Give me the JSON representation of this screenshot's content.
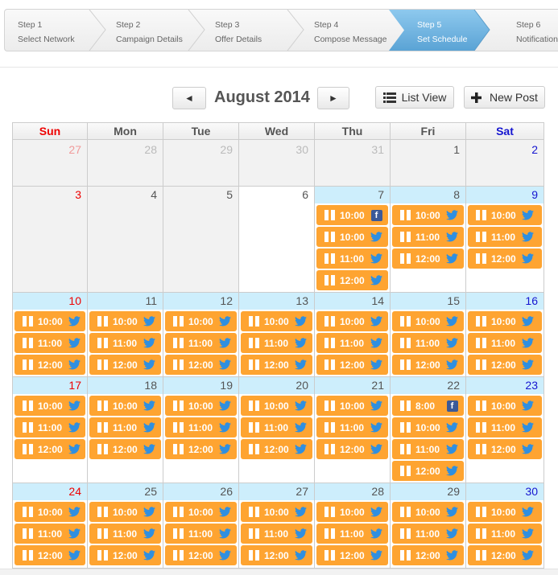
{
  "wizard": {
    "steps": [
      {
        "step": "Step 1",
        "label": "Select Network",
        "active": false
      },
      {
        "step": "Step 2",
        "label": "Campaign Details",
        "active": false
      },
      {
        "step": "Step 3",
        "label": "Offer Details",
        "active": false
      },
      {
        "step": "Step 4",
        "label": "Compose Message",
        "active": false
      },
      {
        "step": "Step 5",
        "label": "Set Schedule",
        "active": true
      },
      {
        "step": "Step 6",
        "label": "Notifications",
        "active": false
      }
    ]
  },
  "toolbar": {
    "prev_icon": "◄",
    "next_icon": "►",
    "month_title": "August 2014",
    "list_view_label": "List View",
    "list_view_icon": "list-icon",
    "new_post_label": "New Post",
    "new_post_icon": "plus-icon"
  },
  "colors": {
    "event_bg": "#fea431",
    "event_row_header": "#cdeefc",
    "active_step": "#6fb3e0",
    "sunday": "#e00000",
    "saturday": "#1515d0",
    "twitter": "#2f8fe0",
    "facebook": "#3b5998"
  },
  "calendar": {
    "days_of_week": [
      "Sun",
      "Mon",
      "Tue",
      "Wed",
      "Thu",
      "Fri",
      "Sat"
    ],
    "weeks": [
      [
        {
          "day": "27",
          "other": true,
          "events": []
        },
        {
          "day": "28",
          "other": true,
          "events": []
        },
        {
          "day": "29",
          "other": true,
          "events": []
        },
        {
          "day": "30",
          "other": true,
          "events": []
        },
        {
          "day": "31",
          "other": true,
          "events": []
        },
        {
          "day": "1",
          "other": false,
          "events": []
        },
        {
          "day": "2",
          "other": false,
          "events": []
        }
      ],
      [
        {
          "day": "3",
          "events": []
        },
        {
          "day": "4",
          "events": []
        },
        {
          "day": "5",
          "events": []
        },
        {
          "day": "6",
          "today": true,
          "events": []
        },
        {
          "day": "7",
          "events": [
            {
              "time": "10:00",
              "network": "facebook"
            },
            {
              "time": "10:00",
              "network": "twitter"
            },
            {
              "time": "11:00",
              "network": "twitter"
            },
            {
              "time": "12:00",
              "network": "twitter"
            }
          ]
        },
        {
          "day": "8",
          "events": [
            {
              "time": "10:00",
              "network": "twitter"
            },
            {
              "time": "11:00",
              "network": "twitter"
            },
            {
              "time": "12:00",
              "network": "twitter"
            }
          ]
        },
        {
          "day": "9",
          "events": [
            {
              "time": "10:00",
              "network": "twitter"
            },
            {
              "time": "11:00",
              "network": "twitter"
            },
            {
              "time": "12:00",
              "network": "twitter"
            }
          ]
        }
      ],
      [
        {
          "day": "10",
          "events": [
            {
              "time": "10:00",
              "network": "twitter"
            },
            {
              "time": "11:00",
              "network": "twitter"
            },
            {
              "time": "12:00",
              "network": "twitter"
            }
          ]
        },
        {
          "day": "11",
          "events": [
            {
              "time": "10:00",
              "network": "twitter"
            },
            {
              "time": "11:00",
              "network": "twitter"
            },
            {
              "time": "12:00",
              "network": "twitter"
            }
          ]
        },
        {
          "day": "12",
          "events": [
            {
              "time": "10:00",
              "network": "twitter"
            },
            {
              "time": "11:00",
              "network": "twitter"
            },
            {
              "time": "12:00",
              "network": "twitter"
            }
          ]
        },
        {
          "day": "13",
          "events": [
            {
              "time": "10:00",
              "network": "twitter"
            },
            {
              "time": "11:00",
              "network": "twitter"
            },
            {
              "time": "12:00",
              "network": "twitter"
            }
          ]
        },
        {
          "day": "14",
          "events": [
            {
              "time": "10:00",
              "network": "twitter"
            },
            {
              "time": "11:00",
              "network": "twitter"
            },
            {
              "time": "12:00",
              "network": "twitter"
            }
          ]
        },
        {
          "day": "15",
          "events": [
            {
              "time": "10:00",
              "network": "twitter"
            },
            {
              "time": "11:00",
              "network": "twitter"
            },
            {
              "time": "12:00",
              "network": "twitter"
            }
          ]
        },
        {
          "day": "16",
          "events": [
            {
              "time": "10:00",
              "network": "twitter"
            },
            {
              "time": "11:00",
              "network": "twitter"
            },
            {
              "time": "12:00",
              "network": "twitter"
            }
          ]
        }
      ],
      [
        {
          "day": "17",
          "events": [
            {
              "time": "10:00",
              "network": "twitter"
            },
            {
              "time": "11:00",
              "network": "twitter"
            },
            {
              "time": "12:00",
              "network": "twitter"
            }
          ]
        },
        {
          "day": "18",
          "events": [
            {
              "time": "10:00",
              "network": "twitter"
            },
            {
              "time": "11:00",
              "network": "twitter"
            },
            {
              "time": "12:00",
              "network": "twitter"
            }
          ]
        },
        {
          "day": "19",
          "events": [
            {
              "time": "10:00",
              "network": "twitter"
            },
            {
              "time": "11:00",
              "network": "twitter"
            },
            {
              "time": "12:00",
              "network": "twitter"
            }
          ]
        },
        {
          "day": "20",
          "events": [
            {
              "time": "10:00",
              "network": "twitter"
            },
            {
              "time": "11:00",
              "network": "twitter"
            },
            {
              "time": "12:00",
              "network": "twitter"
            }
          ]
        },
        {
          "day": "21",
          "events": [
            {
              "time": "10:00",
              "network": "twitter"
            },
            {
              "time": "11:00",
              "network": "twitter"
            },
            {
              "time": "12:00",
              "network": "twitter"
            }
          ]
        },
        {
          "day": "22",
          "events": [
            {
              "time": "8:00",
              "network": "facebook"
            },
            {
              "time": "10:00",
              "network": "twitter"
            },
            {
              "time": "11:00",
              "network": "twitter"
            },
            {
              "time": "12:00",
              "network": "twitter"
            }
          ]
        },
        {
          "day": "23",
          "events": [
            {
              "time": "10:00",
              "network": "twitter"
            },
            {
              "time": "11:00",
              "network": "twitter"
            },
            {
              "time": "12:00",
              "network": "twitter"
            }
          ]
        }
      ],
      [
        {
          "day": "24",
          "events": [
            {
              "time": "10:00",
              "network": "twitter"
            },
            {
              "time": "11:00",
              "network": "twitter"
            },
            {
              "time": "12:00",
              "network": "twitter"
            }
          ]
        },
        {
          "day": "25",
          "events": [
            {
              "time": "10:00",
              "network": "twitter"
            },
            {
              "time": "11:00",
              "network": "twitter"
            },
            {
              "time": "12:00",
              "network": "twitter"
            }
          ]
        },
        {
          "day": "26",
          "events": [
            {
              "time": "10:00",
              "network": "twitter"
            },
            {
              "time": "11:00",
              "network": "twitter"
            },
            {
              "time": "12:00",
              "network": "twitter"
            }
          ]
        },
        {
          "day": "27",
          "events": [
            {
              "time": "10:00",
              "network": "twitter"
            },
            {
              "time": "11:00",
              "network": "twitter"
            },
            {
              "time": "12:00",
              "network": "twitter"
            }
          ]
        },
        {
          "day": "28",
          "events": [
            {
              "time": "10:00",
              "network": "twitter"
            },
            {
              "time": "11:00",
              "network": "twitter"
            },
            {
              "time": "12:00",
              "network": "twitter"
            }
          ]
        },
        {
          "day": "29",
          "events": [
            {
              "time": "10:00",
              "network": "twitter"
            },
            {
              "time": "11:00",
              "network": "twitter"
            },
            {
              "time": "12:00",
              "network": "twitter"
            }
          ]
        },
        {
          "day": "30",
          "events": [
            {
              "time": "10:00",
              "network": "twitter"
            },
            {
              "time": "11:00",
              "network": "twitter"
            },
            {
              "time": "12:00",
              "network": "twitter"
            }
          ]
        }
      ]
    ]
  }
}
